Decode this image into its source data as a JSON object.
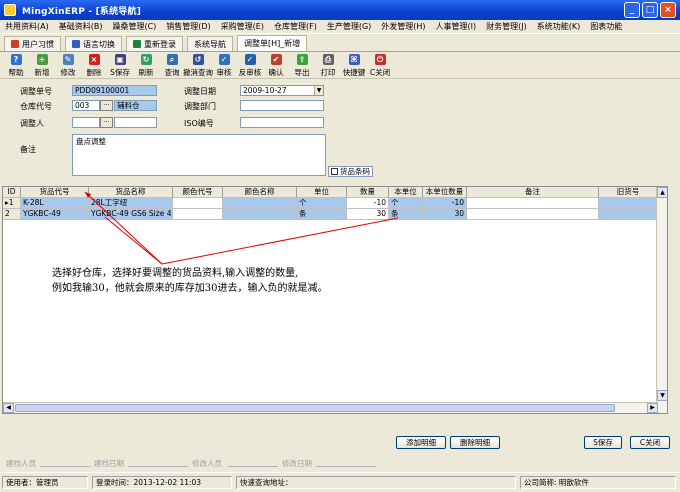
{
  "window": {
    "title": "MingXinERP - [系统导航]"
  },
  "menu": [
    "共用资料(A)",
    "基础资料(B)",
    "躁桑管理(C)",
    "销售管理(D)",
    "采购管理(E)",
    "仓库管理(F)",
    "生产管理(G)",
    "外发管理(H)",
    "人事管理(I)",
    "财务管理(J)",
    "系统功能(K)",
    "图表功能"
  ],
  "quick_tabs": [
    {
      "label": "用户习惯",
      "color": "#d04020"
    },
    {
      "label": "语言切换",
      "color": "#3060c0"
    },
    {
      "label": "重新登录",
      "color": "#208040"
    },
    {
      "label": "系统导航",
      "color": ""
    },
    {
      "label": "调整单[H]_新增",
      "color": ""
    }
  ],
  "toolbar": [
    {
      "label": "帮助",
      "icon": "help-icon",
      "color": "#3070d0",
      "glyph": "?"
    },
    {
      "label": "新增",
      "icon": "new-icon",
      "color": "#4a9a40",
      "glyph": "+"
    },
    {
      "label": "修改",
      "icon": "edit-icon",
      "color": "#5080c0",
      "glyph": "✎"
    },
    {
      "label": "删除",
      "icon": "delete-icon",
      "color": "#d02020",
      "glyph": "×"
    },
    {
      "label": "S保存",
      "icon": "save-icon",
      "color": "#404080",
      "glyph": "▣"
    },
    {
      "label": "刷新",
      "icon": "refresh-icon",
      "color": "#30a060",
      "glyph": "↻"
    },
    {
      "label": "查询",
      "icon": "query-icon",
      "color": "#3070b0",
      "glyph": "⌕"
    },
    {
      "label": "撤消查询",
      "icon": "cancel-query-icon",
      "color": "#3050a0",
      "glyph": "↺"
    },
    {
      "label": "审核",
      "icon": "audit-icon",
      "color": "#3070c0",
      "glyph": "✓"
    },
    {
      "label": "反审核",
      "icon": "unaudit-icon",
      "color": "#2060b0",
      "glyph": "✓"
    },
    {
      "label": "确认",
      "icon": "confirm-icon",
      "color": "#c04030",
      "glyph": "✔"
    },
    {
      "label": "导出",
      "icon": "export-icon",
      "color": "#40a040",
      "glyph": "⇪"
    },
    {
      "label": "打印",
      "icon": "print-icon",
      "color": "#606060",
      "glyph": "⎙"
    },
    {
      "label": "快捷键",
      "icon": "shortcut-icon",
      "color": "#4060c0",
      "glyph": "⌘"
    },
    {
      "label": "C关闭",
      "icon": "close-doc-icon",
      "color": "#c03030",
      "glyph": "⏻"
    }
  ],
  "form": {
    "doc_no_label": "调整单号",
    "doc_no": "PDD09100001",
    "date_label": "调整日期",
    "date": "2009-10-27",
    "warehouse_label": "仓库代号",
    "warehouse_code": "003",
    "warehouse_name": "辅料仓",
    "dept_label": "调整部门",
    "dept": "",
    "person_label": "调整人",
    "person": "",
    "iso_label": "ISO编号",
    "iso": "",
    "remark_label": "备注",
    "remark": "盘点调整",
    "barcode_label": "货品条码"
  },
  "grid": {
    "headers": [
      "ID",
      "货品代号",
      "货品名称",
      "颜色代号",
      "颜色名称",
      "单位",
      "数量",
      "本单位",
      "本单位数量",
      "备注",
      "旧货号"
    ],
    "rows": [
      [
        "1",
        "K-28L",
        "28L工字纽",
        "",
        "",
        "个",
        "-10",
        "个",
        "-10",
        "",
        ""
      ],
      [
        "2",
        "YGKBC-49",
        "YGKBC-49 GS6 Size 4 A",
        "",
        "",
        "条",
        "30",
        "条",
        "30",
        "",
        ""
      ]
    ]
  },
  "annotation": {
    "line1": "选择好仓库，选择好要调整的货品资料,输入调整的数量,",
    "line2": "例如我输30，他就会原来的库存加30进去，输入负的就是减。"
  },
  "buttons": {
    "add_detail": "添加明细",
    "delete_detail": "删除明细",
    "save": "S保存",
    "close": "C关闭"
  },
  "audit": {
    "creator": "建档人员",
    "create_date": "建档日期",
    "modifier": "修改人员",
    "modify_date": "修改日期"
  },
  "status": {
    "user": "使用者：管理员",
    "login_time": "登录时间：2013-12-02 11:03",
    "quick_query": "快速查询地址：",
    "company": "公司简称: 明歆软件"
  }
}
